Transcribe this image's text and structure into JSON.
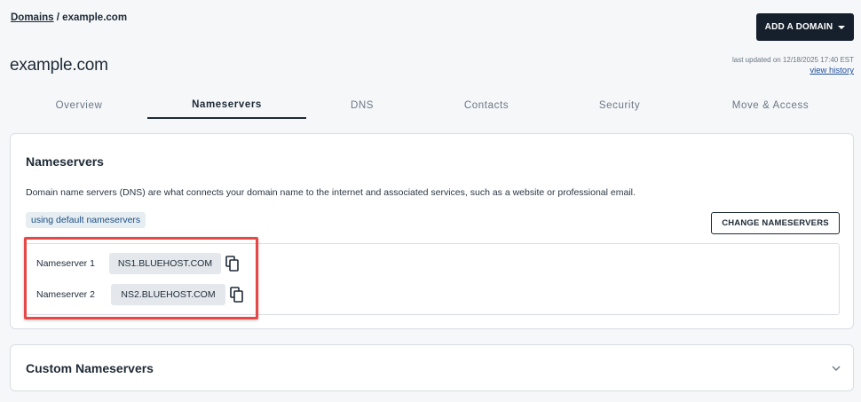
{
  "breadcrumb": {
    "link_label": "Domains",
    "separator": " / ",
    "current": "example.com"
  },
  "header": {
    "add_domain_label": "ADD A DOMAIN",
    "domain_title": "example.com",
    "last_updated": "last updated on 12/18/2025 17:40 EST",
    "view_history_label": "view history"
  },
  "tabs": [
    {
      "label": "Overview"
    },
    {
      "label": "Nameservers",
      "active": true
    },
    {
      "label": "DNS"
    },
    {
      "label": "Contacts"
    },
    {
      "label": "Security"
    },
    {
      "label": "Move & Access"
    }
  ],
  "nameservers_card": {
    "title": "Nameservers",
    "description": "Domain name servers (DNS) are what connects your domain name to the internet and associated services, such as a website or professional email.",
    "badge": "using default nameservers",
    "change_button_label": "CHANGE NAMESERVERS",
    "rows": [
      {
        "label": "Nameserver 1",
        "value": "NS1.BLUEHOST.COM"
      },
      {
        "label": "Nameserver 2",
        "value": "NS2.BLUEHOST.COM"
      }
    ]
  },
  "custom_card": {
    "title": "Custom Nameservers"
  },
  "colors": {
    "primary_dark": "#16202c",
    "highlight_red": "#e64848",
    "link_blue": "#1f4e9c",
    "badge_bg": "#e6eef2"
  }
}
